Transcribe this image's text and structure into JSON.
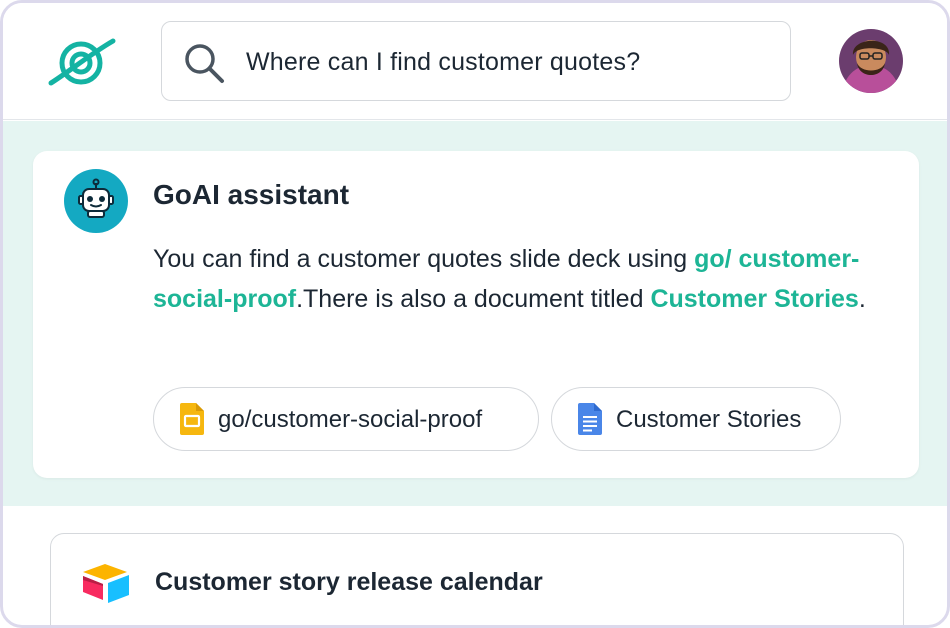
{
  "header": {
    "logo_icon": "orbit-logo-icon",
    "search": {
      "icon": "search-icon",
      "query": "Where can I find customer quotes?"
    },
    "avatar_icon": "user-avatar"
  },
  "assistant": {
    "avatar_icon": "robot-icon",
    "name": "GoAI assistant",
    "answer": {
      "part1": "You can find a customer quotes slide deck using ",
      "link1": "go/ customer-social-proof",
      "part2": ".There is also a document titled ",
      "link2": "Customer Stories",
      "part3": "."
    },
    "sources": [
      {
        "label": "go/customer-social-proof",
        "icon": "google-slides-icon"
      },
      {
        "label": "Customer Stories",
        "icon": "google-docs-icon"
      }
    ]
  },
  "results": [
    {
      "title": "Customer story release calendar",
      "icon": "airtable-icon"
    }
  ],
  "colors": {
    "accent": "#1db596",
    "panel_bg": "#e5f5f2",
    "bot_bg": "#14a9c2"
  }
}
